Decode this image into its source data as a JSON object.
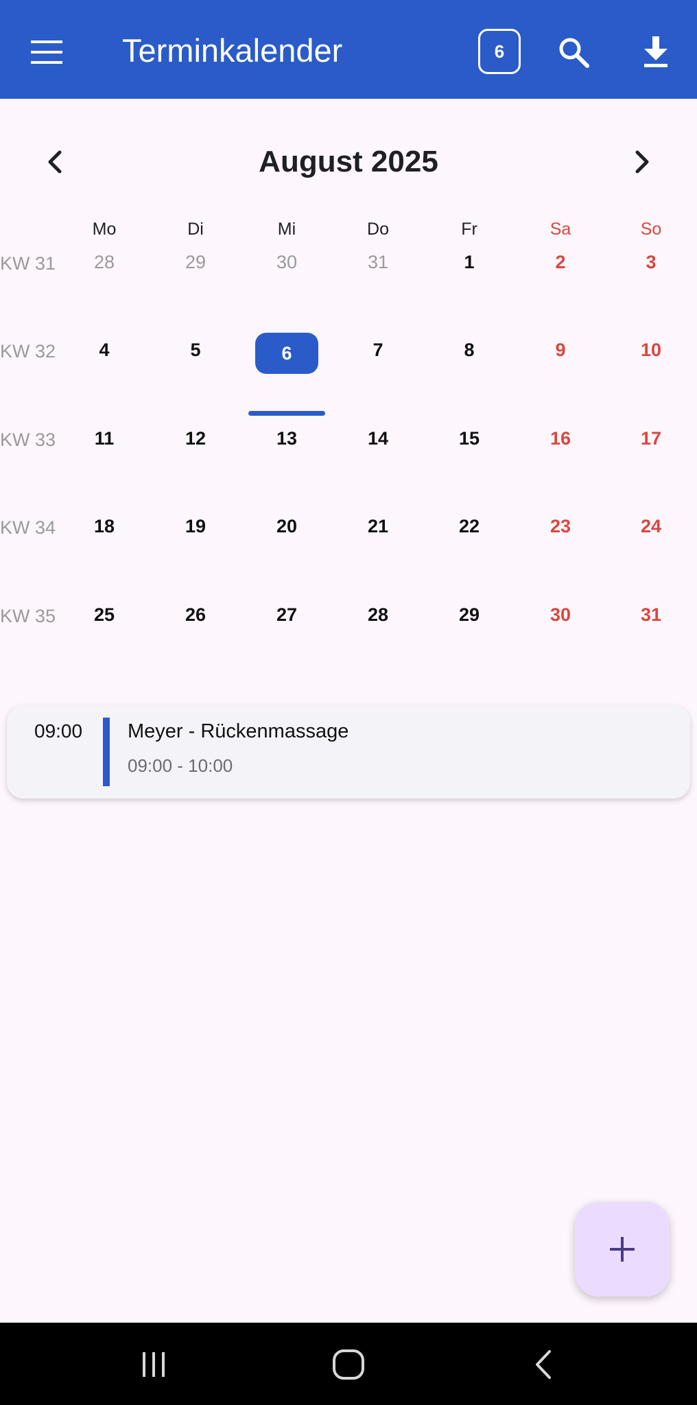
{
  "app": {
    "title": "Terminkalender",
    "today_badge": "6",
    "accent": "#2a5bc9",
    "weekend_color": "#d9473f",
    "icons": {
      "menu": "menu-icon",
      "search": "search-icon",
      "download": "download-icon",
      "add": "plus-icon"
    }
  },
  "calendar": {
    "month_title": "August 2025",
    "weekdays": [
      "Mo",
      "Di",
      "Mi",
      "Do",
      "Fr",
      "Sa",
      "So"
    ],
    "weeks": [
      {
        "kw": "KW 31",
        "days": [
          "28",
          "29",
          "30",
          "31",
          "1",
          "2",
          "3"
        ]
      },
      {
        "kw": "KW 32",
        "days": [
          "4",
          "5",
          "6",
          "7",
          "8",
          "9",
          "10"
        ]
      },
      {
        "kw": "KW 33",
        "days": [
          "11",
          "12",
          "13",
          "14",
          "15",
          "16",
          "17"
        ]
      },
      {
        "kw": "KW 34",
        "days": [
          "18",
          "19",
          "20",
          "21",
          "22",
          "23",
          "24"
        ]
      },
      {
        "kw": "KW 35",
        "days": [
          "25",
          "26",
          "27",
          "28",
          "29",
          "30",
          "31"
        ]
      }
    ],
    "selected_day": "6"
  },
  "events": [
    {
      "time": "09:00",
      "title": "Meyer - Rückenmassage",
      "range": "09:00 - 10:00"
    }
  ]
}
